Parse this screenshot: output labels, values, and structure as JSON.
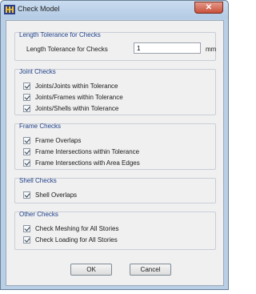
{
  "window": {
    "title": "Check Model",
    "close_glyph": "✕"
  },
  "length_tolerance": {
    "title": "Length Tolerance for Checks",
    "label": "Length Tolerance for Checks",
    "value": "1",
    "unit": "mm"
  },
  "joint_checks": {
    "title": "Joint Checks",
    "items": [
      {
        "label": "Joints/Joints within Tolerance",
        "checked": true
      },
      {
        "label": "Joints/Frames within Tolerance",
        "checked": true
      },
      {
        "label": "Joints/Shells within Tolerance",
        "checked": true
      }
    ]
  },
  "frame_checks": {
    "title": "Frame Checks",
    "items": [
      {
        "label": "Frame Overlaps",
        "checked": true
      },
      {
        "label": "Frame Intersections within Tolerance",
        "checked": true
      },
      {
        "label": "Frame Intersections with Area Edges",
        "checked": true
      }
    ]
  },
  "shell_checks": {
    "title": "Shell Checks",
    "items": [
      {
        "label": "Shell Overlaps",
        "checked": true
      }
    ]
  },
  "other_checks": {
    "title": "Other Checks",
    "items": [
      {
        "label": "Check Meshing for All Stories",
        "checked": true
      },
      {
        "label": "Check Loading for All Stories",
        "checked": true
      }
    ]
  },
  "buttons": {
    "ok": "OK",
    "cancel": "Cancel"
  },
  "icons": {
    "app": "etabs-app-icon",
    "close": "close-icon",
    "check": "checkmark-icon"
  }
}
